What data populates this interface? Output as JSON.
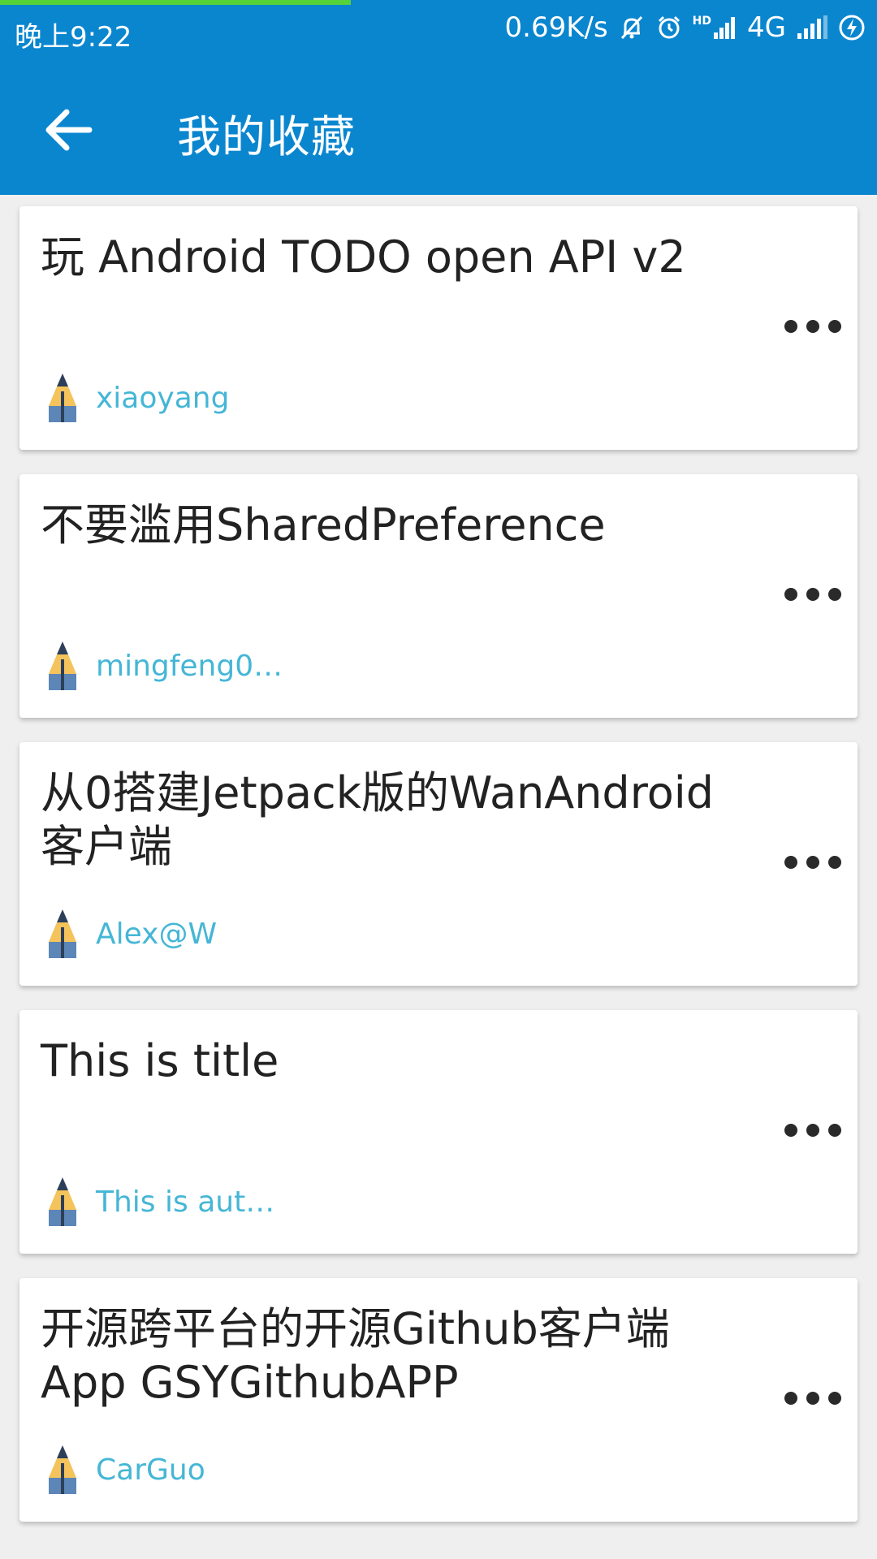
{
  "status_bar": {
    "time": "晚上9:22",
    "net_speed": "0.69K/s",
    "network": "4G",
    "hd_label": "HD",
    "progress": 0.4
  },
  "toolbar": {
    "title": "我的收藏"
  },
  "icons": {
    "back": "arrow-left-icon",
    "more": "more-horizontal-icon",
    "author": "pencil-icon"
  },
  "colors": {
    "primary": "#0a86cf",
    "progress": "#56d23a",
    "author_text": "#45b6d6",
    "background": "#efefef"
  },
  "items": [
    {
      "title": "玩 Android TODO open API v2",
      "author": "xiaoyang"
    },
    {
      "title": "不要滥用SharedPreference",
      "author": "mingfeng0…"
    },
    {
      "title": " 从0搭建Jetpack版的WanAndroid客户端",
      "author": "Alex@W"
    },
    {
      "title": "This is title",
      "author": "This is aut…"
    },
    {
      "title": "开源跨平台的开源Github客户端App GSYGithubAPP",
      "author": "CarGuo"
    }
  ]
}
